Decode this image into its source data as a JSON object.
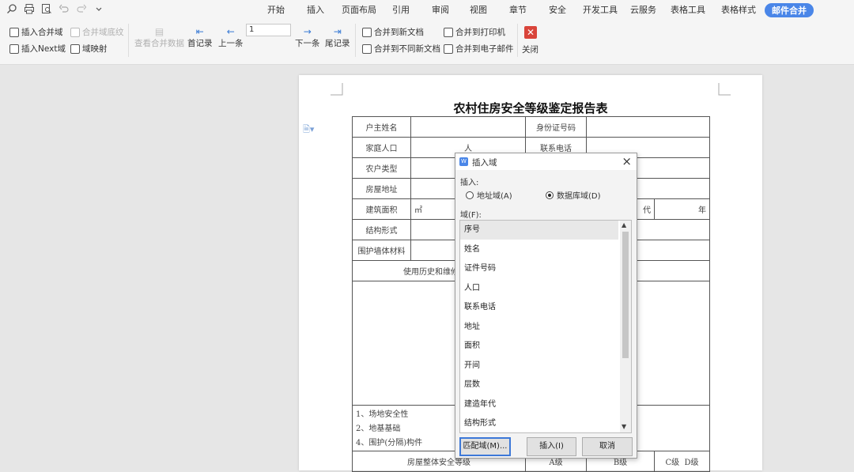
{
  "menu_tabs": [
    "开始",
    "插入",
    "页面布局",
    "引用",
    "审阅",
    "视图",
    "章节",
    "安全",
    "开发工具",
    "云服务",
    "表格工具",
    "表格样式"
  ],
  "active_tab": "邮件合并",
  "toolbar": {
    "insert_merge_field": "插入合并域",
    "merge_field_shading": "合并域底纹",
    "insert_next_field": "插入Next域",
    "field_mapping": "域映射",
    "view_merge_data": "查看合并数据",
    "first_record": "首记录",
    "prev_record": "上一条",
    "record_number": "1",
    "next_record": "下一条",
    "last_record": "尾记录",
    "merge_new_doc": "合并到新文档",
    "merge_diff_docs": "合并到不同新文档",
    "merge_printer": "合并到打印机",
    "merge_email": "合并到电子邮件",
    "close": "关闭"
  },
  "document": {
    "title": "农村住房安全等级鉴定报告表",
    "row_owner": "户主姓名",
    "row_id": "身份证号码",
    "row_family": "家庭人口",
    "row_family_unit": "人",
    "row_phone": "联系电话",
    "row_type": "农户类型",
    "row_address": "房屋地址",
    "row_area": "建筑面积",
    "row_area_unit": "㎡",
    "row_year_frag": "代",
    "row_year_unit": "年",
    "row_structure": "结构形式",
    "row_wall": "围护墙体材料",
    "row_history": "使用历史和维修情况",
    "item1": "1、场地安全性",
    "item2": "2、地基基础",
    "item4": "4、围护(分隔)构件",
    "row_overall": "房屋整体安全等级",
    "grade_a": "A级",
    "grade_b": "B级",
    "grade_c": "C级",
    "grade_d": "D级"
  },
  "dialog": {
    "title": "插入域",
    "insert_label": "插入:",
    "radio_address": "地址域(A)",
    "radio_database": "数据库域(D)",
    "selected_radio": "数据库域(D)",
    "fields_label": "域(F):",
    "fields": [
      "序号",
      "姓名",
      "证件号码",
      "人口",
      "联系电话",
      "地址",
      "面积",
      "开间",
      "层数",
      "建造年代",
      "结构形式"
    ],
    "selected_field": "序号",
    "btn_match": "匹配域(M)...",
    "btn_insert": "插入(I)",
    "btn_cancel": "取消"
  }
}
